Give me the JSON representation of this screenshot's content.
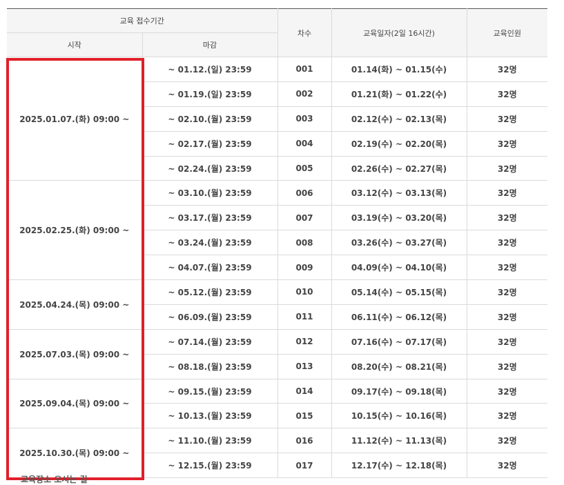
{
  "headers": {
    "reception_period": "교육 접수기간",
    "start": "시작",
    "deadline": "마감",
    "round": "차수",
    "training_dates": "교육일자(2일 16시간)",
    "capacity": "교육인원"
  },
  "groups": [
    {
      "start": "2025.01.07.(화) 09:00 ~",
      "rows": [
        {
          "deadline": "~ 01.12.(일) 23:59",
          "round": "001",
          "dates": "01.14(화) ~ 01.15(수)",
          "capacity": "32명"
        },
        {
          "deadline": "~ 01.19.(일) 23:59",
          "round": "002",
          "dates": "01.21(화) ~ 01.22(수)",
          "capacity": "32명"
        },
        {
          "deadline": "~ 02.10.(월) 23:59",
          "round": "003",
          "dates": "02.12(수) ~ 02.13(목)",
          "capacity": "32명"
        },
        {
          "deadline": "~ 02.17.(월) 23:59",
          "round": "004",
          "dates": "02.19(수) ~ 02.20(목)",
          "capacity": "32명"
        },
        {
          "deadline": "~ 02.24.(월) 23:59",
          "round": "005",
          "dates": "02.26(수) ~ 02.27(목)",
          "capacity": "32명"
        }
      ]
    },
    {
      "start": "2025.02.25.(화) 09:00 ~",
      "rows": [
        {
          "deadline": "~ 03.10.(월) 23:59",
          "round": "006",
          "dates": "03.12(수) ~ 03.13(목)",
          "capacity": "32명"
        },
        {
          "deadline": "~ 03.17.(월) 23:59",
          "round": "007",
          "dates": "03.19(수) ~ 03.20(목)",
          "capacity": "32명"
        },
        {
          "deadline": "~ 03.24.(월) 23:59",
          "round": "008",
          "dates": "03.26(수) ~ 03.27(목)",
          "capacity": "32명"
        },
        {
          "deadline": "~ 04.07.(월) 23:59",
          "round": "009",
          "dates": "04.09(수) ~ 04.10(목)",
          "capacity": "32명"
        }
      ]
    },
    {
      "start": "2025.04.24.(목) 09:00 ~",
      "rows": [
        {
          "deadline": "~ 05.12.(월) 23:59",
          "round": "010",
          "dates": "05.14(수) ~ 05.15(목)",
          "capacity": "32명"
        },
        {
          "deadline": "~ 06.09.(월) 23:59",
          "round": "011",
          "dates": "06.11(수) ~ 06.12(목)",
          "capacity": "32명"
        }
      ]
    },
    {
      "start": "2025.07.03.(목) 09:00 ~",
      "rows": [
        {
          "deadline": "~ 07.14.(월) 23:59",
          "round": "012",
          "dates": "07.16(수) ~ 07.17(목)",
          "capacity": "32명"
        },
        {
          "deadline": "~ 08.18.(월) 23:59",
          "round": "013",
          "dates": "08.20(수) ~ 08.21(목)",
          "capacity": "32명"
        }
      ]
    },
    {
      "start": "2025.09.04.(목) 09:00 ~",
      "rows": [
        {
          "deadline": "~ 09.15.(월) 23:59",
          "round": "014",
          "dates": "09.17(수) ~ 09.18(목)",
          "capacity": "32명"
        },
        {
          "deadline": "~ 10.13.(월) 23:59",
          "round": "015",
          "dates": "10.15(수) ~ 10.16(목)",
          "capacity": "32명"
        }
      ]
    },
    {
      "start": "2025.10.30.(목) 09:00 ~",
      "rows": [
        {
          "deadline": "~ 11.10.(월) 23:59",
          "round": "016",
          "dates": "11.12(수) ~ 11.13(목)",
          "capacity": "32명"
        },
        {
          "deadline": "~ 12.15.(월) 23:59",
          "round": "017",
          "dates": "12.17(수) ~ 12.18(목)",
          "capacity": "32명"
        }
      ]
    }
  ],
  "highlight_color": "#e0202a",
  "cutoff_text": "교육장소 오시는 길"
}
